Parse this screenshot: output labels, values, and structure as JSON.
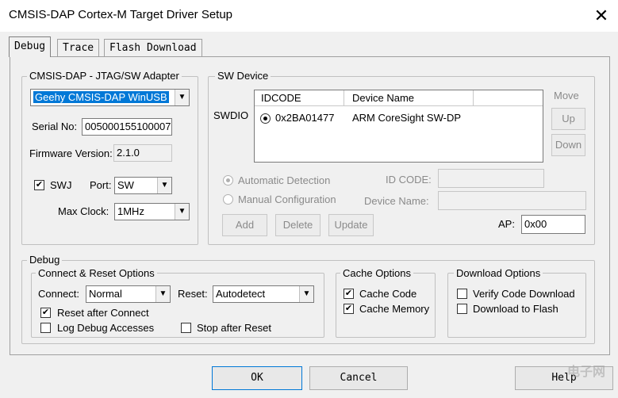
{
  "window": {
    "title": "CMSIS-DAP Cortex-M Target Driver Setup",
    "close_glyph": "✕"
  },
  "tabs": [
    "Debug",
    "Trace",
    "Flash Download"
  ],
  "adapter": {
    "legend": "CMSIS-DAP - JTAG/SW Adapter",
    "selected": "Geehy CMSIS-DAP WinUSB",
    "serial_label": "Serial No:",
    "serial_value": "005000155100007",
    "firmware_label": "Firmware Version:",
    "firmware_value": "2.1.0",
    "swj_label": "SWJ",
    "swj_checked": true,
    "port_label": "Port:",
    "port_value": "SW",
    "clock_label": "Max Clock:",
    "clock_value": "1MHz"
  },
  "sw_device": {
    "legend": "SW Device",
    "swdio_label": "SWDIO",
    "col_idcode": "IDCODE",
    "col_device_name": "Device Name",
    "row_idcode": "0x2BA01477",
    "row_device": "ARM CoreSight SW-DP",
    "move_label": "Move",
    "up": "Up",
    "down": "Down",
    "auto_detect": "Automatic Detection",
    "manual_config": "Manual Configuration",
    "id_code_label": "ID CODE:",
    "device_name_label": "Device Name:",
    "add": "Add",
    "delete": "Delete",
    "update": "Update",
    "ap_label": "AP:",
    "ap_value": "0x00"
  },
  "debug": {
    "legend": "Debug",
    "connect_reset_legend": "Connect & Reset Options",
    "connect_label": "Connect:",
    "connect_value": "Normal",
    "reset_label": "Reset:",
    "reset_value": "Autodetect",
    "reset_after_connect": "Reset after Connect",
    "log_debug_accesses": "Log Debug Accesses",
    "stop_after_reset": "Stop after Reset",
    "cache_legend": "Cache Options",
    "cache_code": "Cache Code",
    "cache_memory": "Cache Memory",
    "download_legend": "Download Options",
    "verify_code_download": "Verify Code Download",
    "download_to_flash": "Download to Flash"
  },
  "footer": {
    "ok": "OK",
    "cancel": "Cancel",
    "help": "Help",
    "watermark": "电子网"
  },
  "colors": {
    "selection": "#0078d7",
    "panel": "#f0f0f0",
    "titlebar": "#ffffff"
  }
}
